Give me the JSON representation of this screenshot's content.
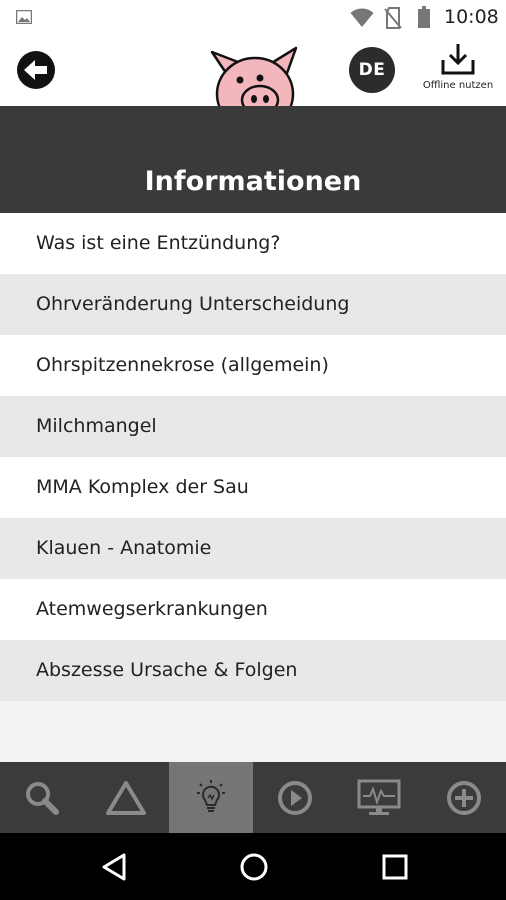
{
  "status_bar": {
    "time": "10:08",
    "icons": [
      "image-icon",
      "wifi-icon",
      "no-sim-icon",
      "battery-icon"
    ]
  },
  "header": {
    "back_icon": "arrow-left-icon",
    "logo": "pig-logo",
    "language": "DE",
    "offline_label": "Offline nutzen",
    "offline_icon": "download-icon"
  },
  "page": {
    "title": "Informationen"
  },
  "list": {
    "items": [
      {
        "label": "Was ist eine Entzündung?"
      },
      {
        "label": "Ohrveränderung Unterscheidung"
      },
      {
        "label": "Ohrspitzennekrose (allgemein)"
      },
      {
        "label": "Milchmangel"
      },
      {
        "label": "MMA Komplex der Sau"
      },
      {
        "label": "Klauen - Anatomie"
      },
      {
        "label": "Atemwegserkrankungen"
      },
      {
        "label": "Abszesse Ursache & Folgen"
      }
    ]
  },
  "bottom_nav": {
    "items": [
      {
        "icon": "search-icon"
      },
      {
        "icon": "triangle-icon"
      },
      {
        "icon": "lightbulb-icon",
        "active": true
      },
      {
        "icon": "play-icon"
      },
      {
        "icon": "monitor-icon"
      },
      {
        "icon": "plus-circle-icon"
      }
    ]
  },
  "system_nav": {
    "icons": [
      "back-triangle-icon",
      "home-circle-icon",
      "recents-square-icon"
    ]
  },
  "colors": {
    "title_band": "#3a3a3a",
    "nav_bg": "#3b3b3b",
    "nav_active": "#757575",
    "row_alt": "#e8e8e8",
    "pig_pink": "#f4b6bd"
  }
}
